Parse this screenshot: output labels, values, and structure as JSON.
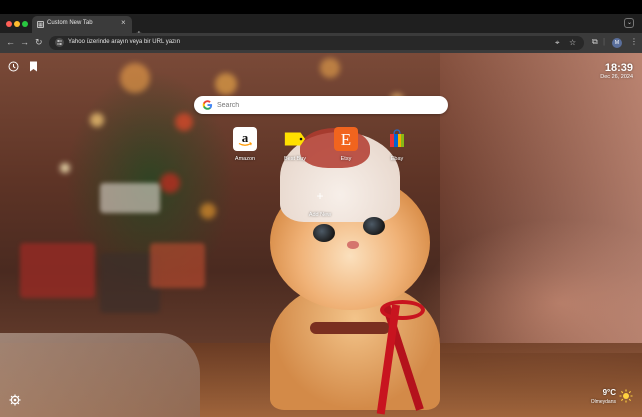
{
  "browser": {
    "tab": {
      "favicon": "grid-icon",
      "title": "Custom New Tab",
      "close_icon": "close-icon"
    },
    "new_tab_icon": "plus-icon",
    "address_bar": {
      "placeholder": "Yahoo üzerinde arayın veya bir URL yazın",
      "left_icon": "tune-icon",
      "right_icons": [
        "location-icon",
        "star-icon"
      ]
    },
    "toolbar_icons": [
      "back-arrow-icon",
      "forward-arrow-icon",
      "reload-icon",
      "extensions-icon",
      "menu-icon"
    ],
    "profile_initial": "M"
  },
  "page": {
    "time": "18:39",
    "date": "Dec 26, 2024",
    "search": {
      "placeholder": "Search",
      "engine_icon": "google-g-icon"
    },
    "shortcuts": [
      {
        "label": "Amazon",
        "icon": "amazon-icon",
        "color": "#ffffff"
      },
      {
        "label": "Best Buy",
        "icon": "bestbuy-tag-icon",
        "color": "#ffe000"
      },
      {
        "label": "Etsy",
        "icon": "etsy-icon",
        "color": "#f1641e"
      },
      {
        "label": "Ebay",
        "icon": "ebay-bag-icon",
        "color": "#0064d2"
      }
    ],
    "add_new": "Add New",
    "weather": {
      "temp": "9°C",
      "desc": "Olmeydans",
      "icon": "sun-icon"
    },
    "top_left_icons": [
      "history-icon",
      "bookmark-icon"
    ],
    "bottom_left_icon": "settings-gear-icon"
  }
}
